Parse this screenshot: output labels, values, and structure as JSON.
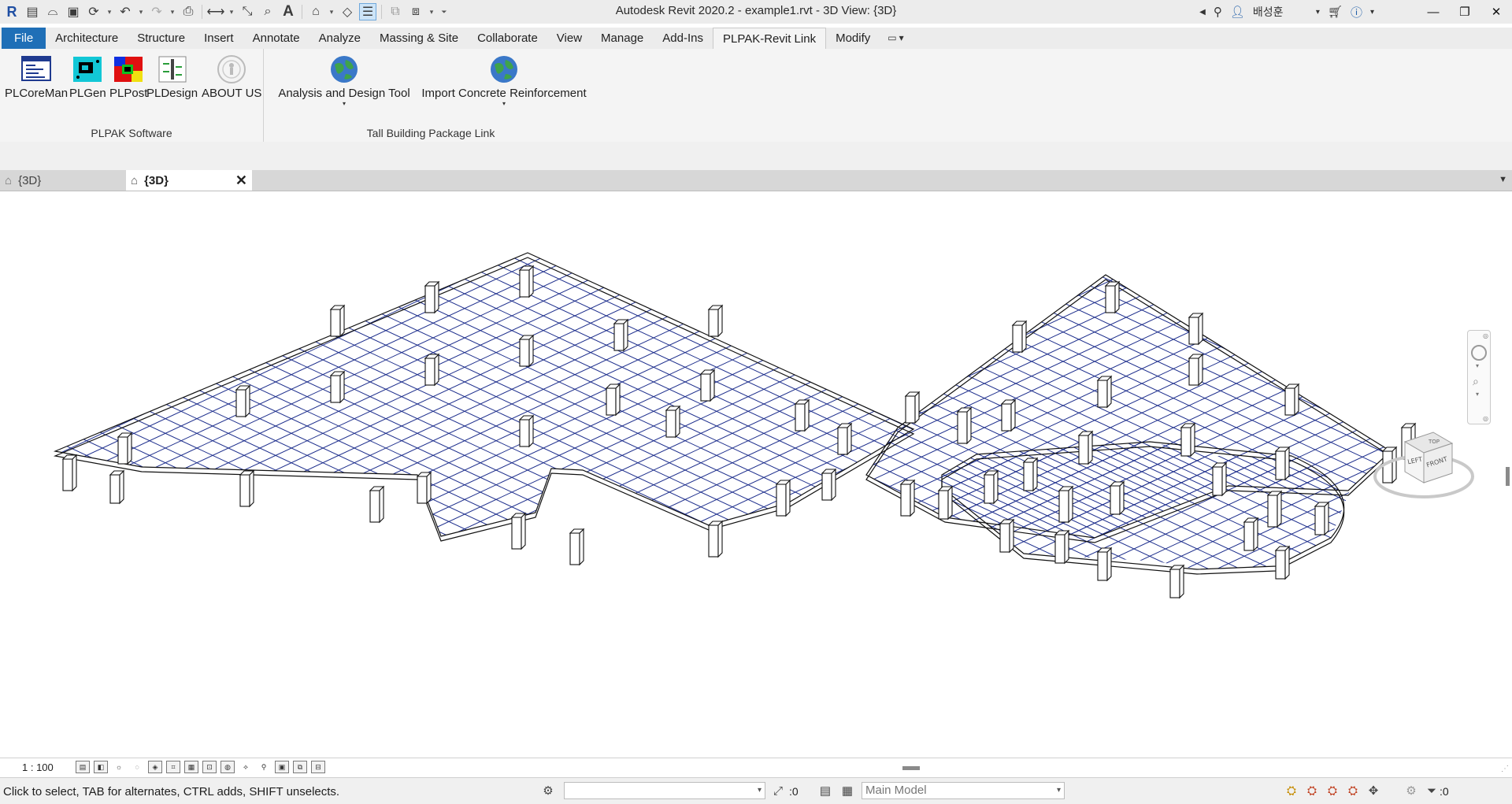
{
  "app": {
    "title": "Autodesk Revit 2020.2 - example1.rvt - 3D View: {3D}",
    "user": "배성훈",
    "colors": {
      "file_tab": "#1f6fb7",
      "ribbon_bg": "#f4f4f4",
      "wireframe": "#000000",
      "grid": "#1c2d8c"
    }
  },
  "qat": {
    "icons": [
      "revit-logo-icon",
      "info-center-icon",
      "open-icon",
      "save-icon",
      "sync-icon",
      "undo-icon",
      "redo-icon",
      "print-icon",
      "measure-icon",
      "dimension-icon",
      "tag-icon",
      "text-icon",
      "3d-view-icon",
      "section-icon",
      "thin-lines-icon",
      "close-hidden-icon",
      "switch-windows-icon",
      "customize-icon"
    ]
  },
  "title_right": {
    "icons": [
      "search-icon",
      "binoculars-icon",
      "user-icon",
      "cart-icon",
      "help-icon",
      "minimize-icon",
      "restore-icon",
      "close-icon"
    ]
  },
  "ribbon_tabs": [
    {
      "label": "File"
    },
    {
      "label": "Architecture"
    },
    {
      "label": "Structure"
    },
    {
      "label": "Insert"
    },
    {
      "label": "Annotate"
    },
    {
      "label": "Analyze"
    },
    {
      "label": "Massing & Site"
    },
    {
      "label": "Collaborate"
    },
    {
      "label": "View"
    },
    {
      "label": "Manage"
    },
    {
      "label": "Add-Ins"
    },
    {
      "label": "PLPAK-Revit Link"
    },
    {
      "label": "Modify"
    }
  ],
  "active_tab": "PLPAK-Revit Link",
  "panels": [
    {
      "title": "PLPAK Software",
      "buttons": [
        {
          "label": "PLCoreMan",
          "icon": "plcoreman-icon"
        },
        {
          "label": "PLGen",
          "icon": "plgen-icon"
        },
        {
          "label": "PLPost",
          "icon": "plpost-icon"
        },
        {
          "label": "PLDesign",
          "icon": "pldesign-icon"
        },
        {
          "label": "ABOUT US",
          "icon": "about-us-icon"
        }
      ]
    },
    {
      "title": "Tall Building Package Link",
      "buttons": [
        {
          "label": "Analysis and Design Tool",
          "icon": "globe-icon"
        },
        {
          "label": "Import Concrete Reinforcement",
          "icon": "globe-icon"
        }
      ]
    }
  ],
  "doc_tabs": [
    {
      "label": "{3D}"
    },
    {
      "label": "{3D}"
    }
  ],
  "viewcube": {
    "faces": [
      "TOP",
      "LEFT",
      "FRONT"
    ]
  },
  "view_controls": {
    "scale": "1 : 100"
  },
  "status": {
    "text": "Click to select, TAB for alternates, CTRL adds, SHIFT unselects.",
    "worksharing_value": ":0",
    "model": "Main Model",
    "filter_count": ":0"
  }
}
